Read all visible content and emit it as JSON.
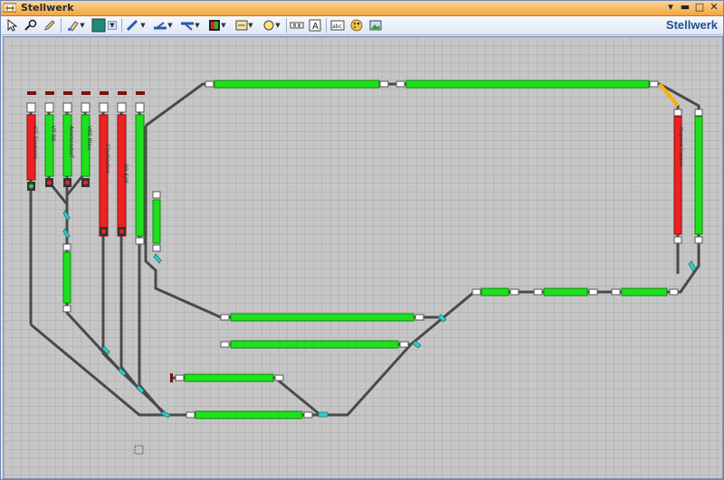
{
  "window": {
    "title": "Stellwerk",
    "controls": [
      "▾",
      "▬",
      "□",
      "✕"
    ]
  },
  "toolbar": {
    "brand": "Stellwerk",
    "tools": [
      {
        "name": "select-arrow-icon",
        "interactable": true
      },
      {
        "name": "zoom-key-icon",
        "interactable": true
      },
      {
        "name": "pencil-icon",
        "interactable": true
      },
      {
        "name": "brush-icon",
        "interactable": true
      },
      {
        "name": "color-swatch-icon",
        "interactable": true,
        "color": "#1f8a7a"
      },
      {
        "name": "straight-track-icon",
        "interactable": true
      },
      {
        "name": "signal-track-icon",
        "interactable": true
      },
      {
        "name": "switch-track-icon",
        "interactable": true
      },
      {
        "name": "signal-block-icon",
        "interactable": true
      },
      {
        "name": "block-frame-icon",
        "interactable": true
      },
      {
        "name": "circle-shape-icon",
        "interactable": true
      },
      {
        "name": "detector-icon",
        "interactable": true
      },
      {
        "name": "text-box-icon",
        "interactable": true
      },
      {
        "name": "abc-label-icon",
        "interactable": true
      },
      {
        "name": "palette-icon",
        "interactable": true
      },
      {
        "name": "image-icon",
        "interactable": true
      }
    ]
  },
  "layout_colors": {
    "grid_bg": "#c3c3c3",
    "grid_line": "#b0b0b0",
    "track": "#555555",
    "block_free": "#1fe01f",
    "block_occupied": "#ee2222",
    "switch_active": "#33cccc",
    "route_yellow": "#f4b400"
  },
  "blocks": [
    {
      "id": "b-siding-1",
      "label": "ICE Siemens",
      "state": "occupied"
    },
    {
      "id": "b-siding-2",
      "label": "VT 98",
      "state": "free"
    },
    {
      "id": "b-siding-3",
      "label": "Ammendorf",
      "state": "free"
    },
    {
      "id": "b-siding-4",
      "label": "V60 Blau",
      "state": "free"
    },
    {
      "id": "b-siding-5",
      "label": "Glaskasten",
      "state": "occupied"
    },
    {
      "id": "b-siding-6",
      "label": "BR 628",
      "state": "occupied"
    },
    {
      "id": "b-siding-7",
      "label": "",
      "state": "free"
    },
    {
      "id": "b-right",
      "label": "Regional Express",
      "state": "occupied"
    },
    {
      "id": "b-right-2",
      "label": "",
      "state": "free"
    }
  ]
}
